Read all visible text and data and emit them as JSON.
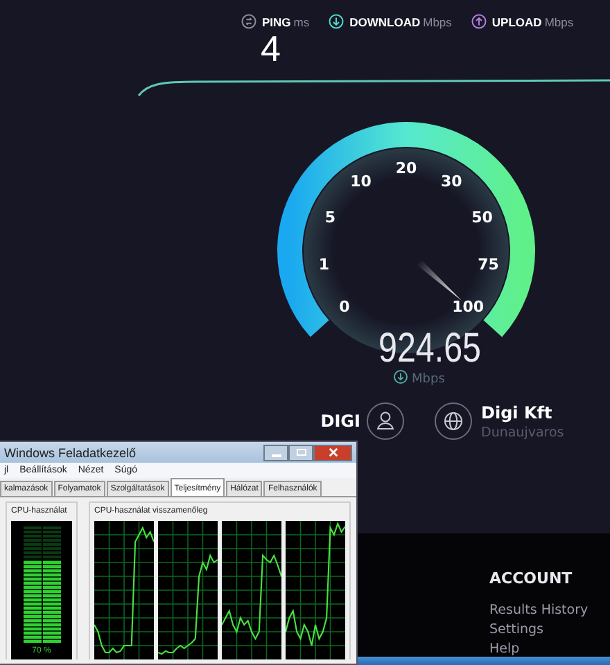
{
  "speedtest": {
    "metrics": [
      {
        "kind": "ping",
        "label": "PING",
        "unit": "ms",
        "value": "4",
        "color": "#8a8c9c"
      },
      {
        "kind": "download",
        "label": "DOWNLOAD",
        "unit": "Mbps",
        "color": "#4fd8c8"
      },
      {
        "kind": "upload",
        "label": "UPLOAD",
        "unit": "Mbps",
        "color": "#b37be0"
      }
    ],
    "gauge": {
      "scale": [
        "0",
        "1",
        "5",
        "10",
        "20",
        "30",
        "50",
        "75",
        "100"
      ],
      "reading": "924.65",
      "unit": "Mbps"
    },
    "isp": {
      "name": "DIGI"
    },
    "server": {
      "name": "Digi Kft",
      "location": "Dunaujvaros"
    }
  },
  "footer": {
    "heading": "ACCOUNT",
    "links": [
      "Results History",
      "Settings",
      "Help"
    ]
  },
  "task_manager": {
    "title": "Windows Feladatkezelő",
    "menu": [
      "jl",
      "Beállítások",
      "Nézet",
      "Súgó"
    ],
    "tabs": [
      {
        "label": "kalmazások",
        "selected": false
      },
      {
        "label": "Folyamatok",
        "selected": false
      },
      {
        "label": "Szolgáltatások",
        "selected": false
      },
      {
        "label": "Teljesítmény",
        "selected": true
      },
      {
        "label": "Hálózat",
        "selected": false
      },
      {
        "label": "Felhasználók",
        "selected": false
      }
    ],
    "cpu_meter": {
      "title": "CPU-használat",
      "level": 0.7,
      "reading": "70 %"
    },
    "history": {
      "title": "CPU-használat visszamenőleg"
    }
  }
}
